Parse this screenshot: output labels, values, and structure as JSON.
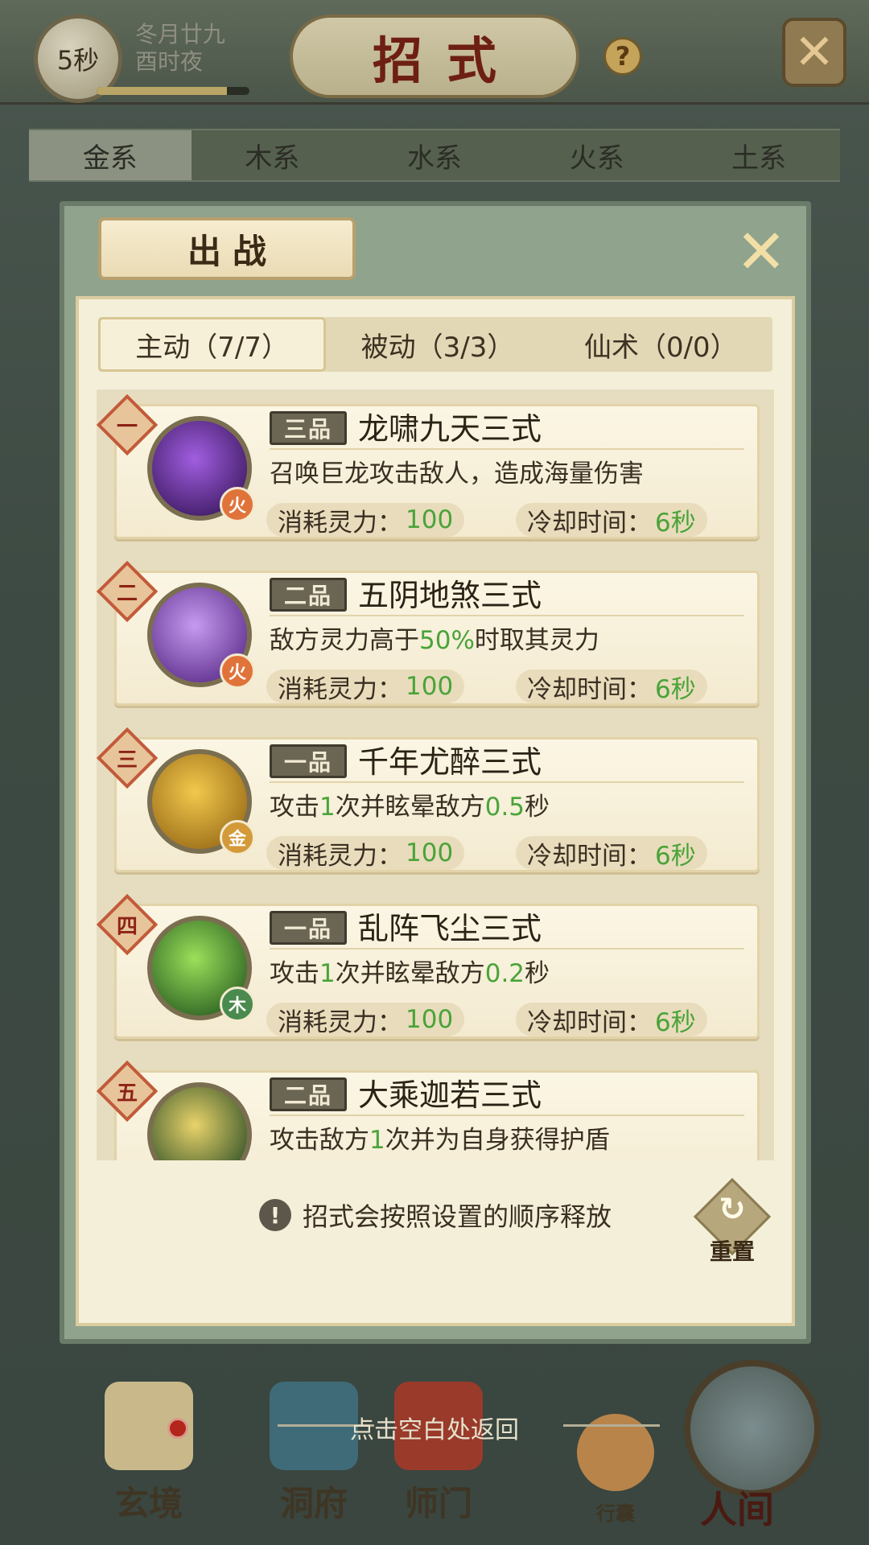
{
  "status": {
    "timer": "5秒",
    "date_line1": "冬月廿九",
    "date_line2": "酉时夜",
    "timer_progress": 0.85
  },
  "screen": {
    "title": "招式",
    "help_label": "?",
    "close_label": "✕"
  },
  "element_tabs": [
    "金系",
    "木系",
    "水系",
    "火系",
    "土系"
  ],
  "popup": {
    "title": "出战",
    "close_label": "✕",
    "tabs": [
      "主动（7/7）",
      "被动（3/3）",
      "仙术（0/0）"
    ],
    "active_tab": 0,
    "skills": [
      {
        "rank": "一",
        "grade": "三品",
        "name": "龙啸九天三式",
        "desc_parts": [
          "召唤巨龙攻击敌人，造成海量伤害"
        ],
        "element": "火",
        "element_color": "#e0733a",
        "icon_colors": [
          "#a15ee0",
          "#2a0d4a"
        ],
        "cost_label": "消耗灵力：",
        "cost_value": "100",
        "cd_label": "冷却时间：",
        "cd_value": "6秒"
      },
      {
        "rank": "二",
        "grade": "二品",
        "name": "五阴地煞三式",
        "desc_parts": [
          "敌方灵力高于",
          "50%",
          "时取其灵力"
        ],
        "element": "火",
        "element_color": "#e0733a",
        "icon_colors": [
          "#c79af0",
          "#4a1c7a"
        ],
        "cost_label": "消耗灵力：",
        "cost_value": "100",
        "cd_label": "冷却时间：",
        "cd_value": "6秒"
      },
      {
        "rank": "三",
        "grade": "一品",
        "name": "千年尤醉三式",
        "desc_parts": [
          "攻击",
          "1",
          "次并眩晕敌方",
          "0.5",
          "秒"
        ],
        "element": "金",
        "element_color": "#d49a3a",
        "icon_colors": [
          "#f2c94c",
          "#8a5a0e"
        ],
        "cost_label": "消耗灵力：",
        "cost_value": "100",
        "cd_label": "冷却时间：",
        "cd_value": "6秒"
      },
      {
        "rank": "四",
        "grade": "一品",
        "name": "乱阵飞尘三式",
        "desc_parts": [
          "攻击",
          "1",
          "次并眩晕敌方",
          "0.2",
          "秒"
        ],
        "element": "木",
        "element_color": "#4a8a4e",
        "icon_colors": [
          "#9be05a",
          "#174a18"
        ],
        "cost_label": "消耗灵力：",
        "cost_value": "100",
        "cd_label": "冷却时间：",
        "cd_value": "6秒"
      },
      {
        "rank": "五",
        "grade": "二品",
        "name": "大乘迦若三式",
        "desc_parts": [
          "攻击敌方",
          "1",
          "次并为自身获得护盾"
        ],
        "element": "",
        "element_color": "#4a8a4e",
        "icon_colors": [
          "#e9d36a",
          "#0f3a1c"
        ],
        "cost_label": "",
        "cost_value": "",
        "cd_label": "",
        "cd_value": ""
      }
    ],
    "notice": "招式会按照设置的顺序释放",
    "notice_icon": "!",
    "reset_label": "重置",
    "reset_icon": "↻"
  },
  "dismiss_hint": "点击空白处返回",
  "bottom_nav": [
    {
      "label": "玄境",
      "icon": "scroll-icon",
      "color": "#c9b98a"
    },
    {
      "label": "洞府",
      "icon": "pavilion-icon",
      "color": "#3f6b78"
    },
    {
      "label": "师门",
      "icon": "gate-icon",
      "color": "#9a3a2a"
    },
    {
      "label": "行囊",
      "icon": "bag-icon",
      "color": "#b8844a"
    }
  ],
  "world_button": "人间"
}
